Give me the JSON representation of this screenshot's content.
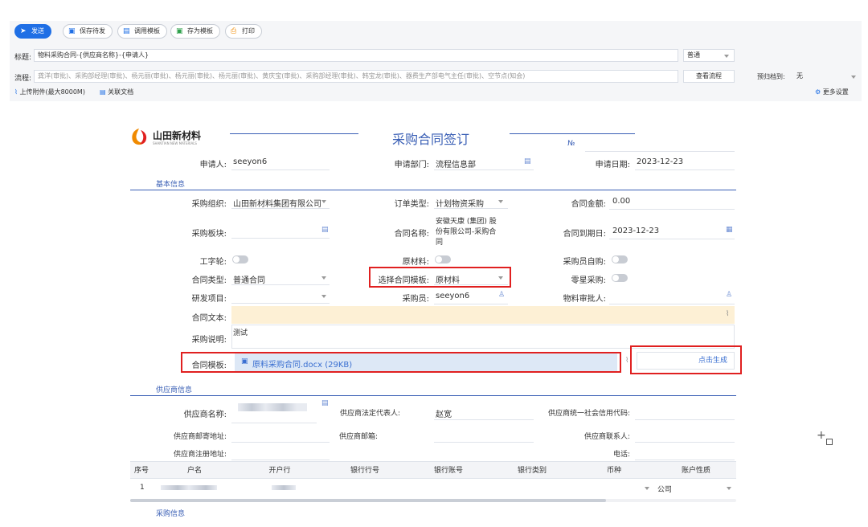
{
  "toolbar": {
    "send": "发送",
    "save_draft": "保存待发",
    "use_template": "调用模板",
    "save_template": "存为模板",
    "print": "打印"
  },
  "title_row": {
    "label": "标题:",
    "value": "物料采购合同-{供应商名称}-{申请人}",
    "priority": "普通"
  },
  "flow_row": {
    "label": "流程:",
    "value": "龚洋(审批)、采购部经理(审批)、杨元丽(审批)、杨元丽(审批)、杨元丽(审批)、黄庆宝(审批)、采购部经理(审批)、韩宝龙(审批)、器费生产部电气主任(审批)、空节点(知会)",
    "view_flow": "查看流程",
    "archive_label": "预归档到:",
    "archive_value": "无"
  },
  "attach_row": {
    "upload": "上传附件(最大8000M)",
    "related": "关联文档",
    "more_settings": "更多设置"
  },
  "form": {
    "logo_text": "山田新材料",
    "logo_sub": "SHANTIAN NEW MATERIALS",
    "title": "采购合同签订",
    "no_label": "№",
    "applicant_label": "申请人:",
    "applicant": "seeyon6",
    "dept_label": "申请部门:",
    "dept": "流程信息部",
    "date_label": "申请日期:",
    "date": "2023-12-23",
    "section_basic": "基本信息",
    "org_label": "采购组织:",
    "org": "山田新材料集团有限公司",
    "order_type_label": "订单类型:",
    "order_type": "计划物资采购",
    "amount_label": "合同金额:",
    "amount": "0.00",
    "block_label": "采购板块:",
    "contract_name_label": "合同名称:",
    "contract_name_l1": "安徽天康 (集团) 股",
    "contract_name_l2": "份有限公司-采购合",
    "contract_name_l3": "同",
    "expire_label": "合同到期日:",
    "expire": "2023-12-23",
    "wheel_label": "工字轮:",
    "raw_label": "原材料:",
    "self_buy_label": "采购员自购:",
    "ctype_label": "合同类型:",
    "ctype": "普通合同",
    "tpl_select_label": "选择合同模板:",
    "tpl_select": "原材料",
    "spare_label": "零星采购:",
    "rd_label": "研发项目:",
    "buyer_label": "采购员:",
    "buyer": "seeyon6",
    "approver_label": "物料审批人:",
    "text_label": "合同文本:",
    "note_label": "采购说明:",
    "note": "测试",
    "tpl_label": "合同模板:",
    "tpl_file": "原料采购合同.docx (29KB)",
    "generate": "点击生成",
    "section_supplier": "供应商信息",
    "sup_name_label": "供应商名称:",
    "legal_label": "供应商法定代表人:",
    "legal": "赵宽",
    "credit_label": "供应商统一社会信用代码:",
    "mail_addr_label": "供应商邮寄地址:",
    "email_label": "供应商邮箱:",
    "contact_label": "供应商联系人:",
    "reg_addr_label": "供应商注册地址:",
    "phone_label": "电话:",
    "table_headers": [
      "序号",
      "户名",
      "开户行",
      "银行行号",
      "银行账号",
      "银行类别",
      "币种",
      "账户性质"
    ],
    "row_no": "1",
    "acct_nature": "公司",
    "section_purchase": "采购信息"
  },
  "colors": {
    "accent": "#1f6fe5",
    "highlight": "#e02020",
    "section": "#3a5fb5"
  }
}
